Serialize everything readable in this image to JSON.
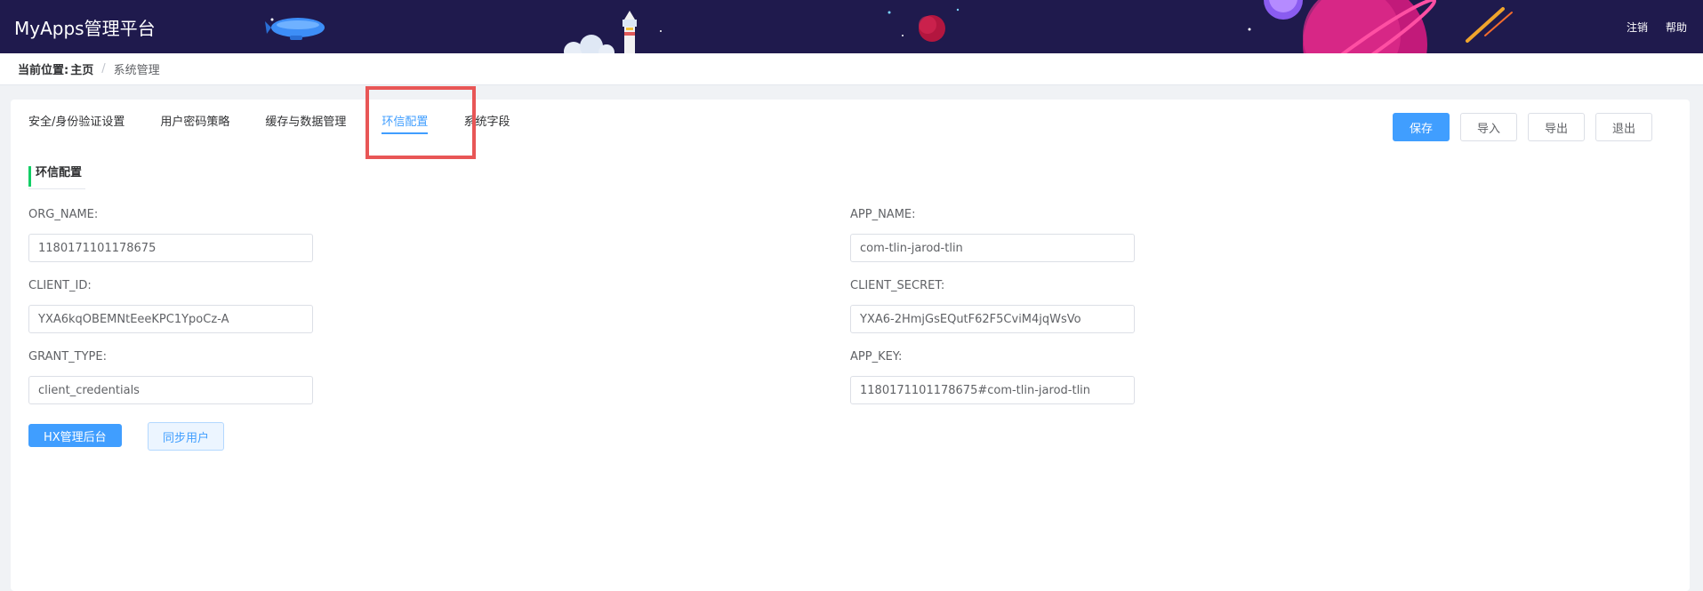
{
  "header": {
    "app_title": "MyApps管理平台",
    "links": {
      "logout": "注销",
      "help": "帮助"
    }
  },
  "breadcrumb": {
    "label": "当前位置:",
    "home": "主页",
    "separator": "/",
    "current": "系统管理"
  },
  "tabs": [
    {
      "label": "安全/身份验证设置",
      "active": false
    },
    {
      "label": "用户密码策略",
      "active": false
    },
    {
      "label": "缓存与数据管理",
      "active": false
    },
    {
      "label": "环信配置",
      "active": true
    },
    {
      "label": "系统字段",
      "active": false
    }
  ],
  "actions": {
    "save": "保存",
    "import": "导入",
    "export": "导出",
    "exit": "退出"
  },
  "section": {
    "title": "环信配置"
  },
  "fields": {
    "org_name": {
      "label": "ORG_NAME:",
      "value": "1180171101178675"
    },
    "app_name": {
      "label": "APP_NAME:",
      "value": "com-tlin-jarod-tlin"
    },
    "client_id": {
      "label": "CLIENT_ID:",
      "value": "YXA6kqOBEMNtEeeKPC1YpoCz-A"
    },
    "client_secret": {
      "label": "CLIENT_SECRET:",
      "value": "YXA6-2HmjGsEQutF62F5CviM4jqWsVo"
    },
    "grant_type": {
      "label": "GRANT_TYPE:",
      "value": "client_credentials"
    },
    "app_key": {
      "label": "APP_KEY:",
      "value": "1180171101178675#com-tlin-jarod-tlin"
    }
  },
  "buttons": {
    "hx_admin": "HX管理后台",
    "sync_users": "同步用户"
  },
  "colors": {
    "header_bg": "#1f1a4d",
    "primary": "#409eff",
    "section_accent": "#13ce66",
    "highlight": "#e85656"
  }
}
